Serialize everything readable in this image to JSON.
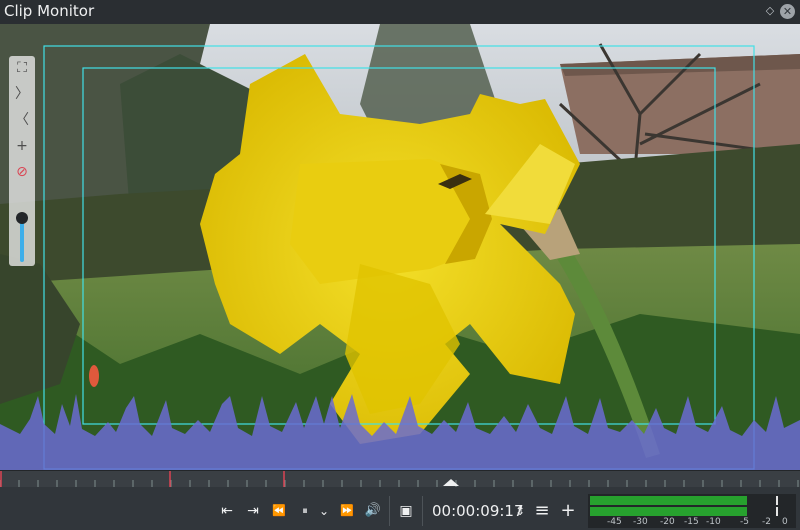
{
  "window": {
    "title": "Clip Monitor"
  },
  "titlebar_icons": {
    "float": "diamond-icon",
    "close": "close-icon",
    "float_glyph": "◇",
    "close_glyph": "✕"
  },
  "overlay_toolbar": {
    "icons": [
      "fit-zoom-icon",
      "next-frame-icon",
      "previous-frame-icon",
      "add-marker-icon",
      "remove-marker-icon"
    ],
    "glyphs": {
      "zoom": "⛶",
      "next": "〉",
      "prev": "〈",
      "add": "+",
      "remove": "⊘"
    },
    "zoom_level": 0.72
  },
  "audio_waveform": {
    "color": "#6a6bd1"
  },
  "transport": {
    "glyphs": {
      "go_start": "⇤",
      "go_end": "⇥",
      "rewind": "⏪",
      "play": "⏸",
      "dropdown": "⌄",
      "forward": "⏩",
      "volume": "🔊",
      "overlay": "▣",
      "spin": "⇕",
      "menu": "≡",
      "add": "+"
    },
    "timecode": "00:00:09:17"
  },
  "audio_meter": {
    "levels": [
      0.77,
      0.77
    ],
    "scale_labels": [
      "-45",
      "-30",
      "-20",
      "-15",
      "-10",
      "-5",
      "-2",
      "0"
    ]
  },
  "colors": {
    "safe_zone": "#41e0e6",
    "accent": "#3daee9",
    "meter_green": "#27a12e"
  }
}
